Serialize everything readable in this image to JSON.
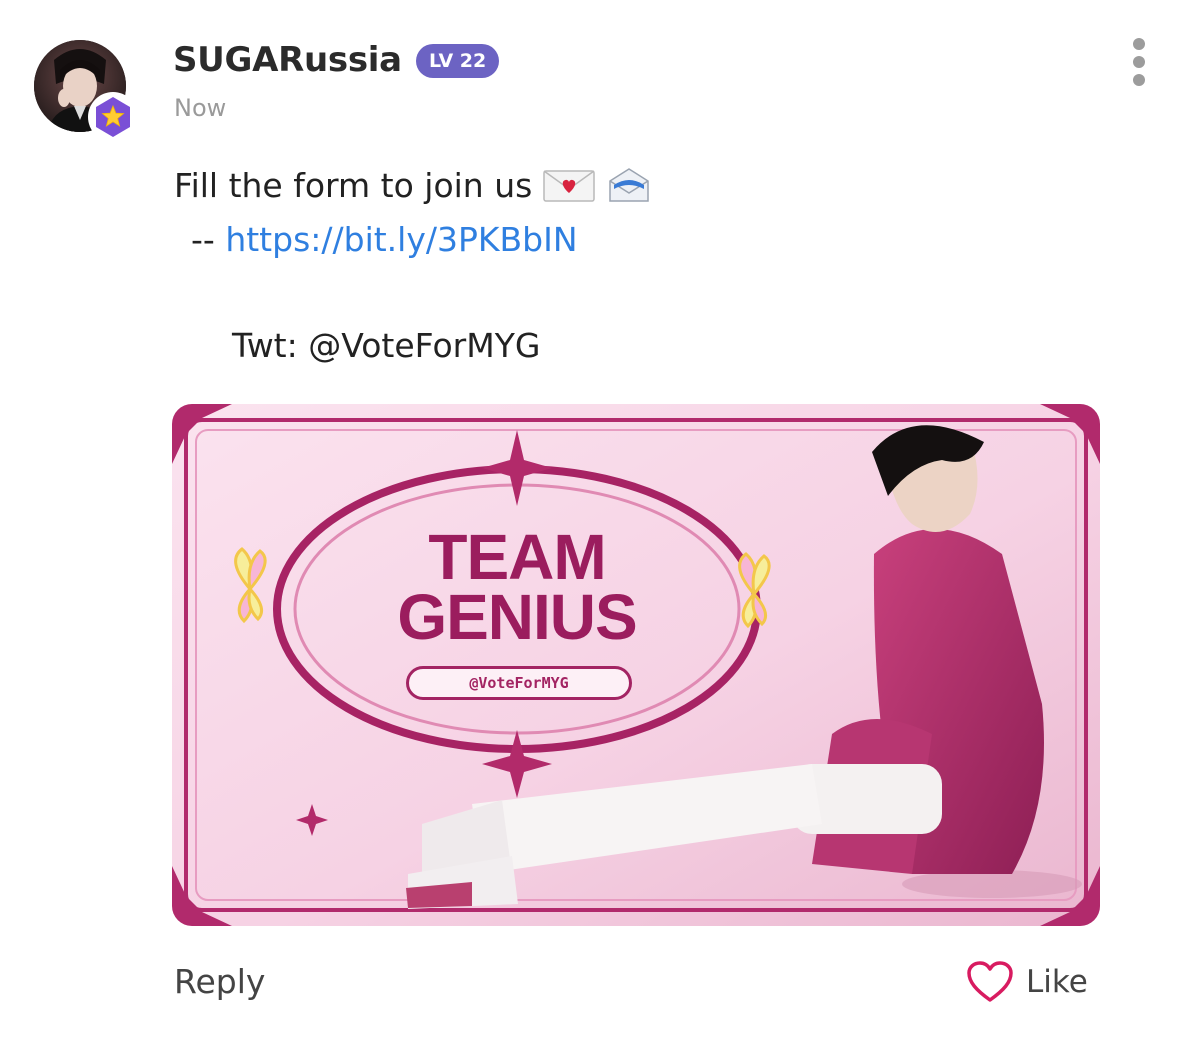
{
  "post": {
    "author": {
      "username": "SUGARussia",
      "level": "LV 22",
      "avatar_icon": "profile-photo",
      "badge_icon": "star-hexagon-badge-icon"
    },
    "timestamp": "Now",
    "content": {
      "line1_text": "Fill the form to join us",
      "line1_emojis": [
        "love-letter-icon",
        "incoming-envelope-icon"
      ],
      "line2_prefix": "--",
      "link": "https://bit.ly/3PKBbIN",
      "line3_text": "Twt: @VoteForMYG"
    },
    "image": {
      "title_line1": "TEAM",
      "title_line2": "GENIUS",
      "handle": "@VoteForMYG"
    },
    "actions": {
      "reply_label": "Reply",
      "like_label": "Like"
    }
  },
  "colors": {
    "accent_link": "#2f7fe0",
    "level_pill": "#6c63c3",
    "badge_purple": "#7a4fd6",
    "badge_star": "#ffcc33",
    "like_heart": "#d81b60",
    "banner_magenta": "#9b1d5e"
  }
}
